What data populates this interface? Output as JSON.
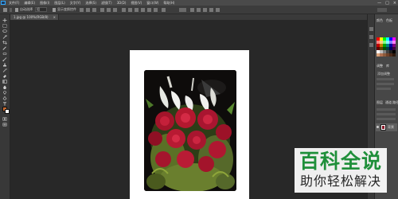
{
  "menu": {
    "items": [
      "文件(F)",
      "编辑(E)",
      "图像(I)",
      "图层(L)",
      "文字(Y)",
      "选择(S)",
      "滤镜(T)",
      "3D(D)",
      "视图(V)",
      "窗口(W)",
      "帮助(H)"
    ],
    "minimize": "—",
    "maximize": "□",
    "close": "×"
  },
  "options": {
    "mode_label": "自动选择",
    "mode_value": "组",
    "transform_label": "显示变换控件"
  },
  "document": {
    "tab_title": "1.jpg @ 100%(RGB/8)",
    "tab_close": "×"
  },
  "colors": {
    "foreground": "#c8692e",
    "background": "#ffffff"
  },
  "panels": {
    "color_tab": "颜色",
    "swatches_tab": "色板",
    "adjust_tab": "调整",
    "libraries_tab": "库",
    "add_adjust": "添加调整",
    "layers_tab": "图层",
    "channels_tab": "通道",
    "paths_tab": "路径",
    "layer_name": "背景"
  },
  "watermark": {
    "title": "百科全说",
    "subtitle": "助你轻松解决"
  }
}
